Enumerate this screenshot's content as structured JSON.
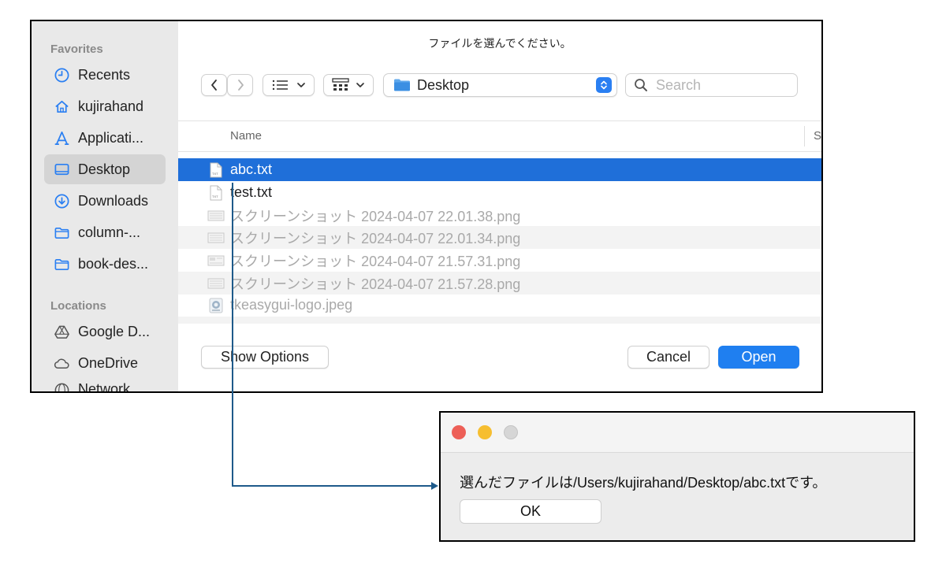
{
  "file_dialog": {
    "title": "ファイルを選んでください。",
    "sidebar": {
      "favorites_label": "Favorites",
      "favorites": [
        {
          "label": "Recents",
          "icon": "clock-icon"
        },
        {
          "label": "kujirahand",
          "icon": "home-icon"
        },
        {
          "label": "Applicati...",
          "icon": "applications-icon"
        },
        {
          "label": "Desktop",
          "icon": "desktop-icon",
          "selected": true
        },
        {
          "label": "Downloads",
          "icon": "download-icon"
        },
        {
          "label": "column-...",
          "icon": "folder-icon"
        },
        {
          "label": "book-des...",
          "icon": "folder-icon"
        }
      ],
      "locations_label": "Locations",
      "locations": [
        {
          "label": "Google D...",
          "icon": "drive-icon"
        },
        {
          "label": "OneDrive",
          "icon": "cloud-icon"
        },
        {
          "label": "Network",
          "icon": "network-icon"
        }
      ]
    },
    "toolbar": {
      "location": "Desktop",
      "search_placeholder": "Search"
    },
    "columns": {
      "name": "Name",
      "size": "S"
    },
    "files": [
      {
        "name": "abc.txt",
        "icon": "text-file-icon",
        "state": "selected"
      },
      {
        "name": "test.txt",
        "icon": "text-file-icon",
        "state": "normal"
      },
      {
        "name": "スクリーンショット 2024-04-07 22.01.38.png",
        "icon": "image-file-icon",
        "state": "disabled"
      },
      {
        "name": "スクリーンショット 2024-04-07 22.01.34.png",
        "icon": "image-file-icon",
        "state": "disabled"
      },
      {
        "name": "スクリーンショット 2024-04-07 21.57.31.png",
        "icon": "image-file-icon",
        "state": "disabled"
      },
      {
        "name": "スクリーンショット 2024-04-07 21.57.28.png",
        "icon": "image-file-icon",
        "state": "disabled"
      },
      {
        "name": "tkeasygui-logo.jpeg",
        "icon": "image-file-icon",
        "state": "disabled"
      }
    ],
    "buttons": {
      "show_options": "Show Options",
      "cancel": "Cancel",
      "open": "Open"
    }
  },
  "result_window": {
    "message": "選んだファイルは/Users/kujirahand/Desktop/abc.txtです。",
    "ok_label": "OK"
  },
  "colors": {
    "accent": "#1f7ff0",
    "selection": "#1f6fd9",
    "connector": "#1e5a8a"
  }
}
